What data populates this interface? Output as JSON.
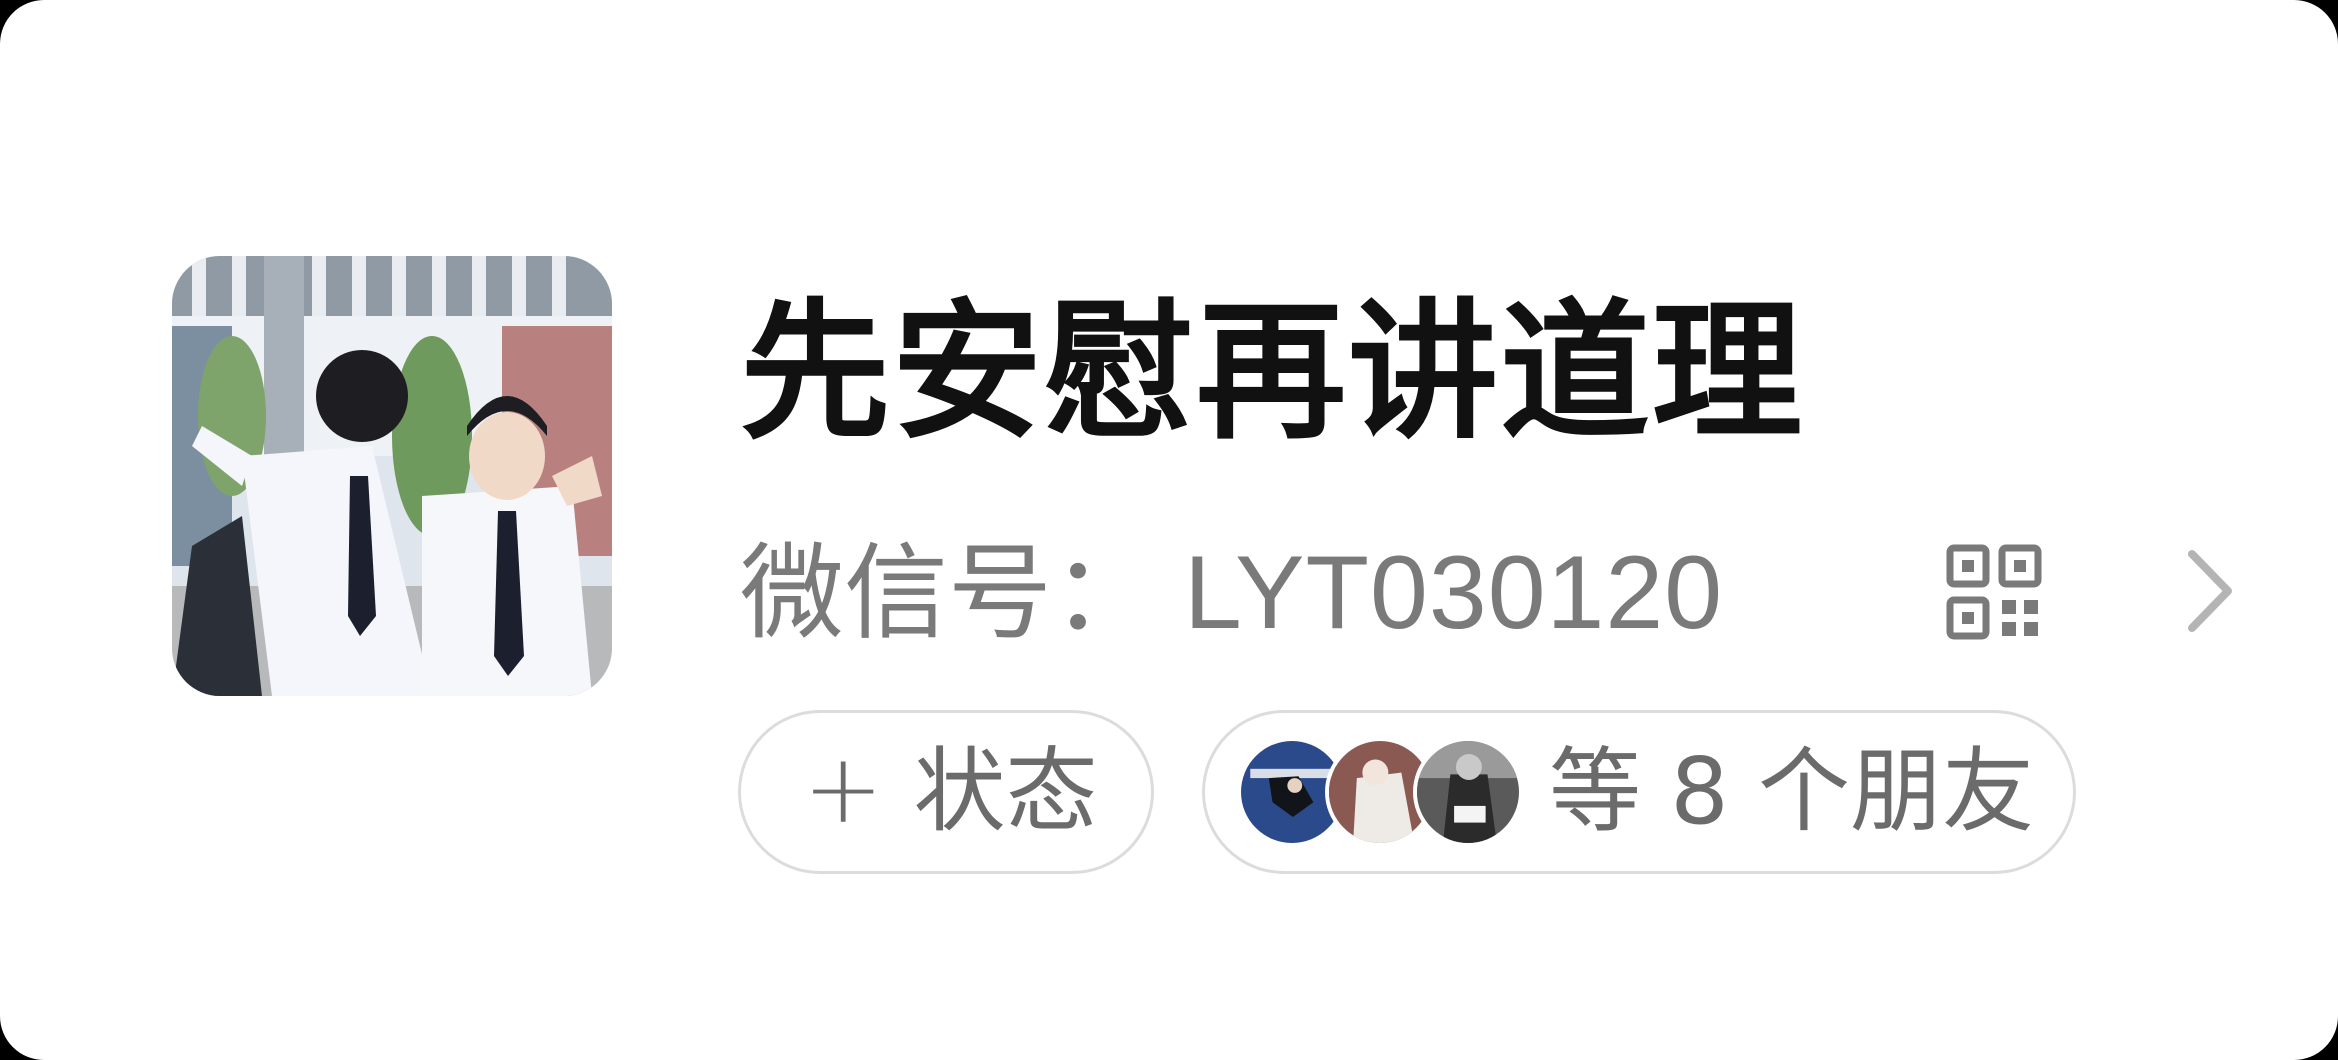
{
  "profile": {
    "nickname": "先安慰再讲道理",
    "wechat_id_label": "微信号：",
    "wechat_id_value": "LYT030120",
    "avatar_icon": "profile-photo",
    "qr_icon": "qr-code-icon",
    "chevron_icon": "chevron-right-icon"
  },
  "status_pill": {
    "plus": "+",
    "label": "状态"
  },
  "friends_pill": {
    "label": "等 8 个朋友",
    "avatars": [
      "friend-avatar-1",
      "friend-avatar-2",
      "friend-avatar-3"
    ]
  },
  "colors": {
    "name_text": "#111111",
    "secondary_text": "#7a7a7a",
    "pill_border": "#dcdcdc",
    "background": "#ffffff"
  }
}
